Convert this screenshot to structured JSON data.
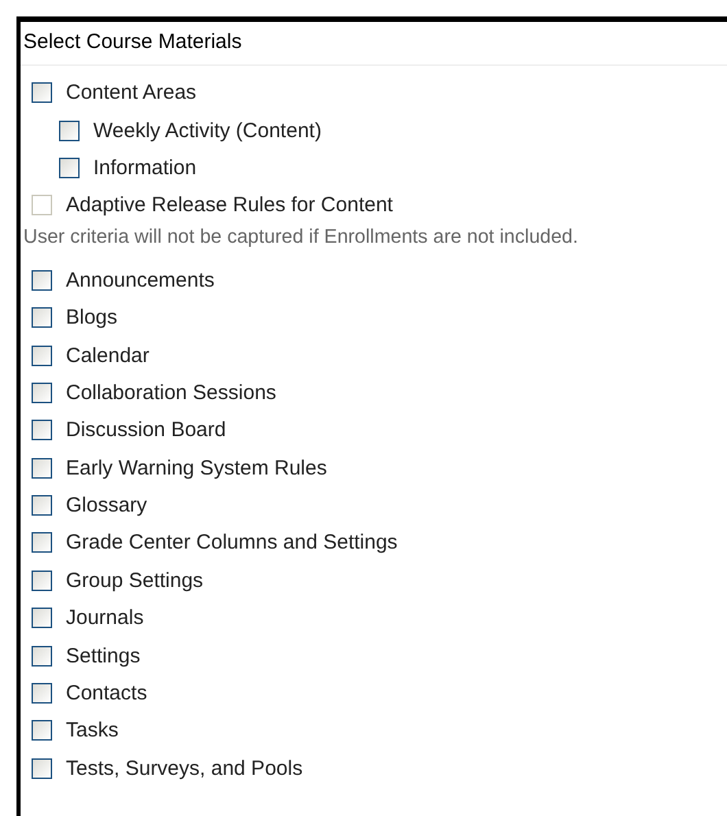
{
  "panel": {
    "title": "Select Course Materials",
    "items": [
      {
        "label": "Content Areas",
        "checked": false,
        "disabled": false,
        "children": [
          {
            "label": "Weekly Activity (Content)",
            "checked": false,
            "disabled": false
          },
          {
            "label": "Information",
            "checked": false,
            "disabled": false
          }
        ]
      },
      {
        "label": "Adaptive Release Rules for Content",
        "checked": false,
        "disabled": true
      }
    ],
    "note": "User criteria will not be captured if Enrollments are not included.",
    "more_items": [
      {
        "label": "Announcements",
        "checked": false,
        "disabled": false
      },
      {
        "label": "Blogs",
        "checked": false,
        "disabled": false
      },
      {
        "label": "Calendar",
        "checked": false,
        "disabled": false
      },
      {
        "label": "Collaboration Sessions",
        "checked": false,
        "disabled": false
      },
      {
        "label": "Discussion Board",
        "checked": false,
        "disabled": false
      },
      {
        "label": "Early Warning System Rules",
        "checked": false,
        "disabled": false
      },
      {
        "label": "Glossary",
        "checked": false,
        "disabled": false
      },
      {
        "label": "Grade Center Columns and Settings",
        "checked": false,
        "disabled": false
      },
      {
        "label": "Group Settings",
        "checked": false,
        "disabled": false
      },
      {
        "label": "Journals",
        "checked": false,
        "disabled": false
      },
      {
        "label": "Settings",
        "checked": false,
        "disabled": false
      },
      {
        "label": "Contacts",
        "checked": false,
        "disabled": false
      },
      {
        "label": "Tasks",
        "checked": false,
        "disabled": false
      },
      {
        "label": "Tests, Surveys, and Pools",
        "checked": false,
        "disabled": false
      }
    ]
  }
}
